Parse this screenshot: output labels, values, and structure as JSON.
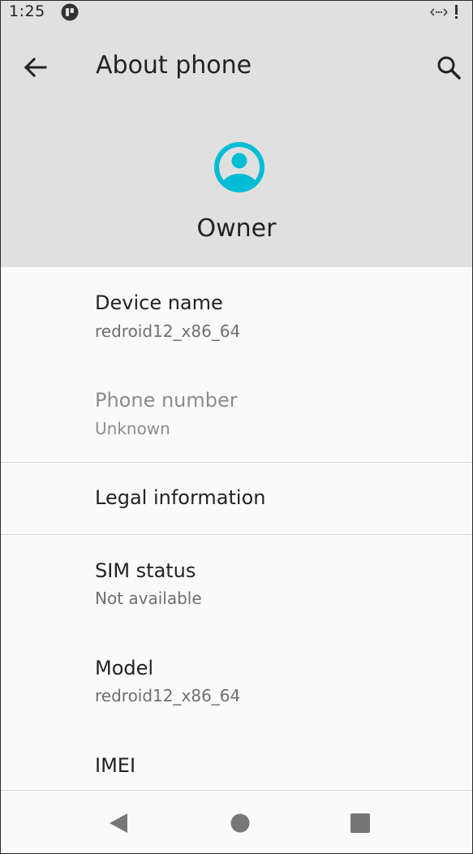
{
  "status_bar": {
    "time": "1:25",
    "icons": [
      "notification-icon",
      "no-internet-icon",
      "battery-alert-icon"
    ]
  },
  "header": {
    "title": "About phone",
    "back_icon": "arrow-back-icon",
    "search_icon": "search-icon",
    "avatar_icon": "account-circle-icon",
    "owner": "Owner",
    "avatar_color": "#00bcd4"
  },
  "items": [
    {
      "title": "Device name",
      "summary": "redroid12_x86_64"
    },
    {
      "title": "Phone number",
      "summary": "Unknown"
    },
    {
      "title": "Legal information"
    },
    {
      "title": "SIM status",
      "summary": "Not available"
    },
    {
      "title": "Model",
      "summary": "redroid12_x86_64"
    },
    {
      "title": "IMEI"
    }
  ],
  "nav_bar": {
    "icons": [
      "nav-back-icon",
      "nav-home-icon",
      "nav-recents-icon"
    ]
  },
  "colors": {
    "header_bg": "#e0e0e0",
    "list_bg": "#fafafa",
    "accent": "#00bcd4"
  }
}
